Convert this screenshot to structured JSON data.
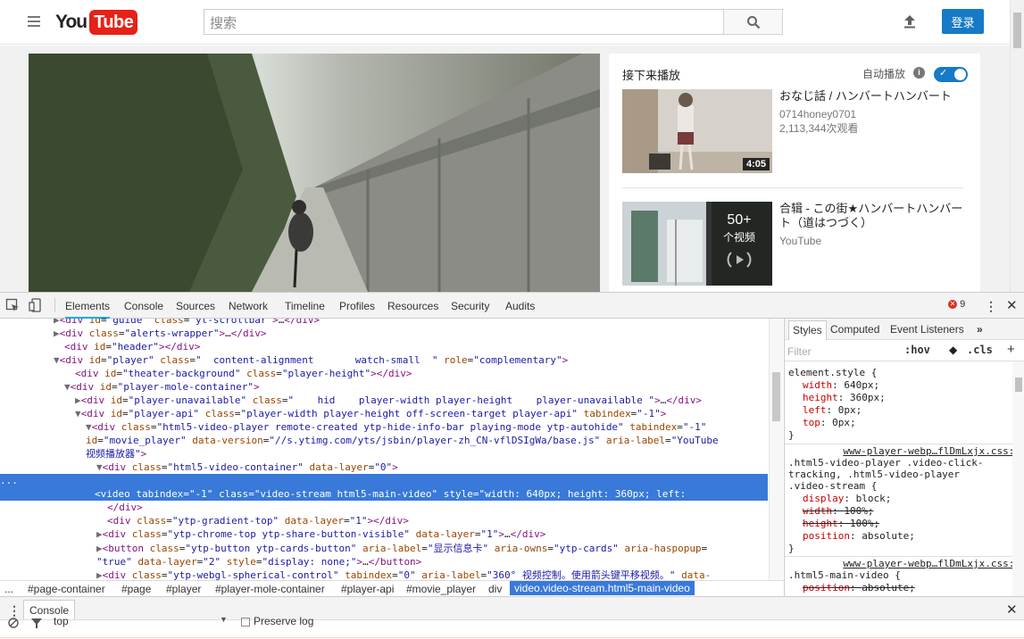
{
  "youtube": {
    "logo_you": "You",
    "logo_tube": "Tube",
    "search_placeholder": "搜索",
    "login": "登录",
    "up_next": "接下来播放",
    "autoplay": "自动播放",
    "videos": [
      {
        "title": "おなじ話 / ハンバートハンバート",
        "channel": "0714honey0701",
        "views": "2,113,344次观看",
        "duration": "4:05"
      },
      {
        "title": "合辑 - この街★ハンバートハンバート（道はつづく）",
        "channel": "YouTube",
        "playlist_count": "50+",
        "playlist_label": "个视频"
      }
    ]
  },
  "devtools": {
    "tabs": [
      "Elements",
      "Console",
      "Sources",
      "Network",
      "Timeline",
      "Profiles",
      "Resources",
      "Security",
      "Audits"
    ],
    "active_tab": "Elements",
    "error_count": "9",
    "style_tabs": [
      "Styles",
      "Computed",
      "Event Listeners"
    ],
    "filter_placeholder": "Filter",
    "hov": ":hov",
    "cls": ".cls",
    "breadcrumbs": [
      "...",
      "#page-container",
      "#page",
      "#player",
      "#player-mole-container",
      "#player-api",
      "#movie_player",
      "div",
      "video.video-stream.html5-main-video"
    ],
    "drawer_tab": "Console",
    "context": "top",
    "preserve_log": "Preserve log",
    "css": {
      "element_style": "element.style {",
      "rules1": [
        {
          "prop": "width",
          "val": "640px;"
        },
        {
          "prop": "height",
          "val": "360px;"
        },
        {
          "prop": "left",
          "val": "0px;"
        },
        {
          "prop": "top",
          "val": "0px;"
        }
      ],
      "src1": "www-player-webp…flDmLxjx.css:1",
      "selector2a": ".html5-video-player .video-click-",
      "selector2b": "tracking, .html5-video-player",
      "selector2c": ".video-stream {",
      "rules2": [
        {
          "prop": "display",
          "val": "block;",
          "struck": false
        },
        {
          "prop": "width",
          "val": "100%;",
          "struck": true
        },
        {
          "prop": "height",
          "val": "100%;",
          "struck": true
        },
        {
          "prop": "position",
          "val": "absolute;",
          "struck": false
        }
      ],
      "src2": "www-player-webp…flDmLxjx.css:1",
      "selector3": ".html5-main-video {",
      "rules3": [
        {
          "prop": "position",
          "val": "absolute;",
          "struck": true
        }
      ],
      "close": "}"
    }
  }
}
